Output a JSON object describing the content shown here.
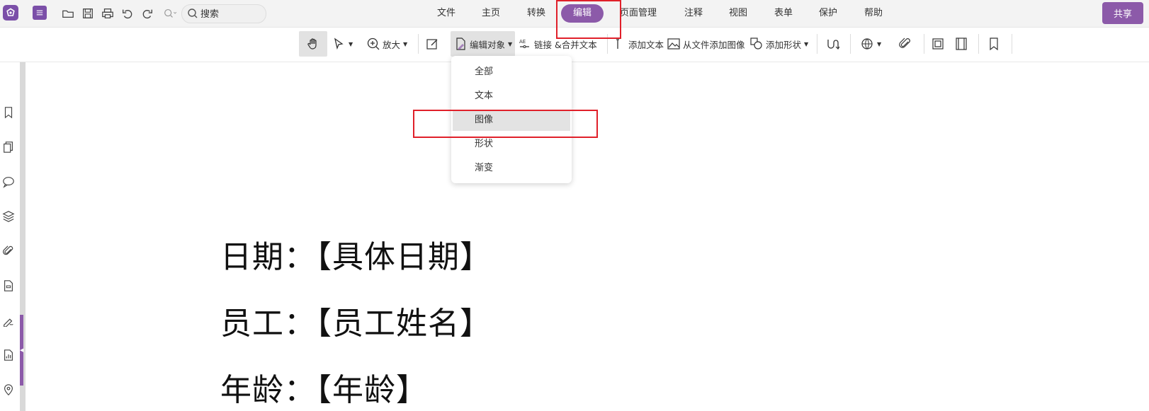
{
  "app": {
    "logo_icon": "app-logo-icon"
  },
  "quick_access": [
    {
      "name": "menu-icon"
    },
    {
      "name": "open-folder-icon"
    },
    {
      "name": "save-icon"
    },
    {
      "name": "print-icon"
    },
    {
      "name": "undo-icon"
    },
    {
      "name": "redo-icon"
    },
    {
      "name": "zoom-dropdown-icon"
    }
  ],
  "search": {
    "placeholder": "搜索"
  },
  "menu_tabs": [
    {
      "label": "文件"
    },
    {
      "label": "主页"
    },
    {
      "label": "转换"
    },
    {
      "label": "编辑",
      "active": true
    },
    {
      "label": "页面管理"
    },
    {
      "label": "注释"
    },
    {
      "label": "视图"
    },
    {
      "label": "表单"
    },
    {
      "label": "保护"
    },
    {
      "label": "帮助"
    }
  ],
  "share_label": "共享",
  "toolbar": {
    "hand": {
      "icon": "hand-icon"
    },
    "select": {
      "icon": "select-arrow-icon"
    },
    "zoom": {
      "label": "放大",
      "icon": "zoom-in-icon"
    },
    "edit_text": {
      "icon": "edit-text-icon"
    },
    "edit_object": {
      "label": "编辑对象",
      "icon": "edit-object-icon"
    },
    "link_merge": {
      "label": "链接 &合并文本",
      "icon": "link-merge-icon"
    },
    "add_text": {
      "label": "添加文本",
      "icon": "add-text-icon"
    },
    "add_image": {
      "label": "从文件添加图像",
      "icon": "add-image-icon"
    },
    "add_shape": {
      "label": "添加形状",
      "icon": "add-shape-icon"
    },
    "other_icons": [
      "path-icon",
      "web-link-icon",
      "attachment-icon",
      "crop-icon",
      "video-icon",
      "bookmark-icon"
    ]
  },
  "dropdown": {
    "items": [
      {
        "label": "全部"
      },
      {
        "label": "文本"
      },
      {
        "label": "图像",
        "hovered": true
      },
      {
        "label": "形状"
      },
      {
        "label": "渐变"
      }
    ]
  },
  "sidebar": {
    "icons": [
      "bookmark-icon",
      "pages-icon",
      "comments-icon",
      "layers-icon",
      "attachment-icon",
      "form-icon",
      "signature-icon",
      "report-icon",
      "location-icon"
    ]
  },
  "document": {
    "lines": [
      "日期：【具体日期】",
      "员工：【员工姓名】",
      "年龄：【年龄】"
    ]
  },
  "colors": {
    "accent": "#8c5aa9",
    "highlight": "#e0202a"
  }
}
